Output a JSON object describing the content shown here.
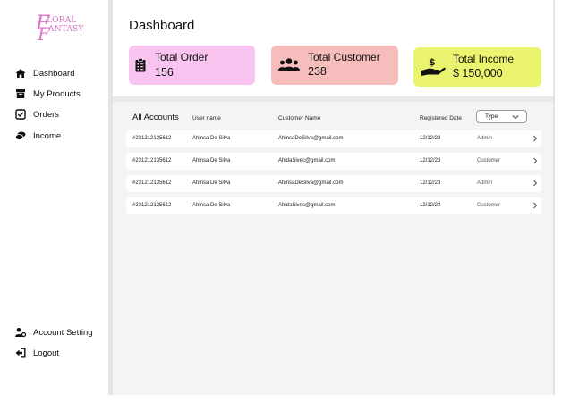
{
  "logo": {
    "line1": "LORAL",
    "line2": "ANTASY",
    "initial1": "F",
    "initial2": "F"
  },
  "sidebar": {
    "items": [
      {
        "label": "Dashboard",
        "icon": "home-icon"
      },
      {
        "label": "My Products",
        "icon": "box-icon"
      },
      {
        "label": "Orders",
        "icon": "checkbox-icon"
      },
      {
        "label": "Income",
        "icon": "money-icon"
      }
    ],
    "bottom": [
      {
        "label": "Account Setting",
        "icon": "user-gear-icon"
      },
      {
        "label": "Logout",
        "icon": "logout-icon"
      }
    ]
  },
  "header": {
    "title": "Dashboard"
  },
  "cards": {
    "orders": {
      "label": "Total Order",
      "value": "156",
      "color": "#f9c5f0",
      "icon": "clipboard-icon"
    },
    "customers": {
      "label": "Total Customer",
      "value": "238",
      "color": "#f7bcbc",
      "icon": "users-icon"
    },
    "income": {
      "label": "Total Income",
      "value": "$ 150,000",
      "color": "#ebf46e",
      "icon": "hand-dollar-icon"
    }
  },
  "accounts": {
    "title": "All Accounts",
    "columns": {
      "username": "User name",
      "customer_name": "Customer Name",
      "registered_date": "Registered Date"
    },
    "type_select": "Type",
    "rows": [
      {
        "id": "#231212135612",
        "username": "Ahinsa De Silva",
        "email": "AhinsaDeSilva@gmail.com",
        "date": "12/12/23",
        "type": "Admin"
      },
      {
        "id": "#231212135612",
        "username": "Ahinsa De Silva",
        "email": "AhidaSivec@gmail.com",
        "date": "12/12/23",
        "type": "Customer"
      },
      {
        "id": "#231212135612",
        "username": "Ahinsa De Silva",
        "email": "AhinsaDeSilva@gmail.com",
        "date": "12/12/23",
        "type": "Admin"
      },
      {
        "id": "#231212135612",
        "username": "Ahinsa De Silva",
        "email": "AhidaSivec@gmail.com",
        "date": "12/12/23",
        "type": "Customer"
      }
    ]
  }
}
